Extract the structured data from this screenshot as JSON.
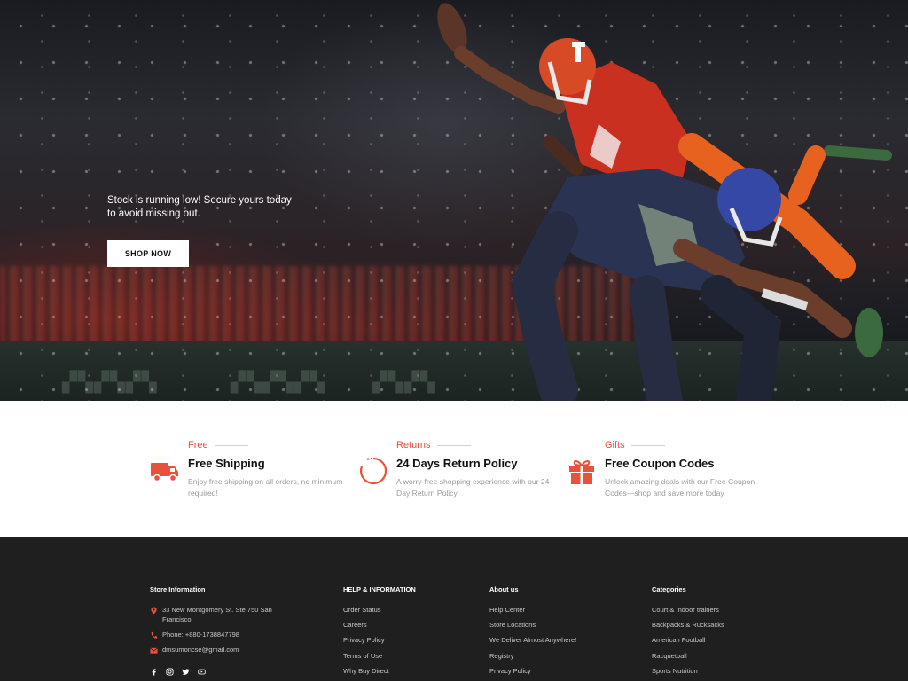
{
  "hero": {
    "tagline": "Stock is running low! Secure yours today to avoid missing out.",
    "cta_label": "SHOP NOW",
    "background_image": "american-football-players"
  },
  "features": [
    {
      "kicker": "Free",
      "title": "Free Shipping",
      "desc": "Enjoy free shipping on all orders, no minimum required!",
      "icon": "truck-icon"
    },
    {
      "kicker": "Returns",
      "title": "24 Days Return Policy",
      "desc": "A worry-free shopping experience with our 24-Day Return Policy",
      "icon": "refresh-icon"
    },
    {
      "kicker": "Gifts",
      "title": "Free Coupon Codes",
      "desc": "Unlock amazing deals with our Free Coupon Codes—shop and save more today",
      "icon": "gift-icon"
    }
  ],
  "accent_color": "#e8513a",
  "footer": {
    "store": {
      "title": "Store Information",
      "address": "33 New Montgomery St. Ste 750 San Francisco",
      "phone": "Phone: +880-1738847798",
      "email": "dmsumoncse@gmail.com",
      "social": [
        "facebook-icon",
        "instagram-icon",
        "twitter-icon",
        "youtube-icon"
      ]
    },
    "help": {
      "title": "HELP & INFORMATION",
      "items": [
        "Order Status",
        "Careers",
        "Privacy Policy",
        "Terms of Use",
        "Why Buy Direct"
      ]
    },
    "about": {
      "title": "About us",
      "items": [
        "Help Center",
        "Store Locations",
        "We Deliver Almost Anywhere!",
        "Registry",
        "Privacy Policy"
      ]
    },
    "categories": {
      "title": "Categories",
      "items": [
        "Court & Indoor trainers",
        "Backpacks & Rucksacks",
        "American Football",
        "Racquetball",
        "Sports Nutrition"
      ]
    }
  }
}
